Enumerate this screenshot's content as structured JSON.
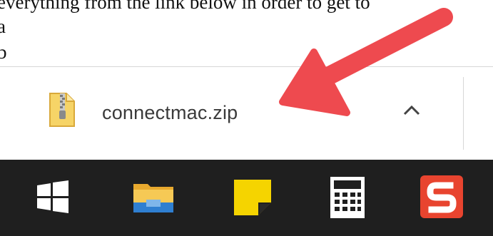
{
  "page_text": {
    "line1": "everything from the link below in order to get to",
    "line2": "a",
    "line3": "b"
  },
  "download_bar": {
    "file_name": "connectmac.zip",
    "file_icon": "zip-file-icon",
    "options_icon": "chevron-up-icon"
  },
  "taskbar": {
    "items": [
      {
        "name": "start",
        "icon": "windows-logo-icon"
      },
      {
        "name": "file-explorer",
        "icon": "folder-icon"
      },
      {
        "name": "sticky-notes",
        "icon": "sticky-note-icon"
      },
      {
        "name": "calculator",
        "icon": "calculator-icon"
      },
      {
        "name": "snagit",
        "icon": "snagit-icon"
      }
    ]
  },
  "colors": {
    "taskbar_bg": "#1f1f1f",
    "arrow": "#ee4a4f",
    "snagit_red": "#e8442f",
    "sticky_yellow": "#f5d400",
    "folder_yellow": "#f2c14e",
    "folder_blue": "#2f7fd1"
  }
}
